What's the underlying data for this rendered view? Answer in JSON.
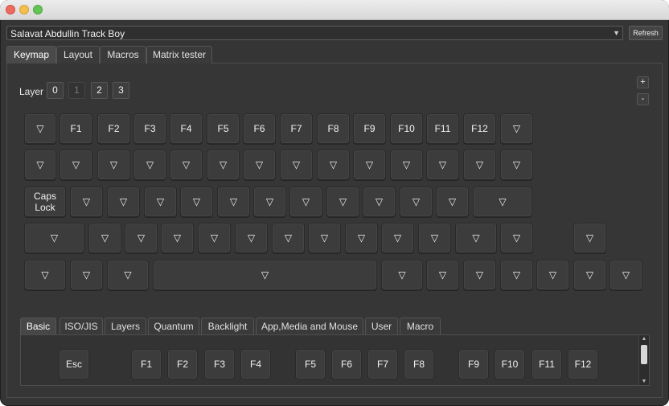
{
  "device": {
    "name": "Salavat Abdullin Track Boy",
    "refresh_label": "Refresh"
  },
  "top_tabs": [
    "Keymap",
    "Layout",
    "Macros",
    "Matrix tester"
  ],
  "active_top_tab": "Keymap",
  "layer": {
    "label": "Layer",
    "options": [
      "0",
      "1",
      "2",
      "3"
    ],
    "active": "1",
    "add_label": "+",
    "remove_label": "-"
  },
  "keymap": {
    "row1": [
      "▽",
      "F1",
      "F2",
      "F3",
      "F4",
      "F5",
      "F6",
      "F7",
      "F8",
      "F9",
      "F10",
      "F11",
      "F12",
      "▽"
    ],
    "row2": [
      "▽",
      "▽",
      "▽",
      "▽",
      "▽",
      "▽",
      "▽",
      "▽",
      "▽",
      "▽",
      "▽",
      "▽",
      "▽",
      "▽"
    ],
    "row3": [
      "Caps\nLock",
      "▽",
      "▽",
      "▽",
      "▽",
      "▽",
      "▽",
      "▽",
      "▽",
      "▽",
      "▽",
      "▽",
      "▽"
    ],
    "row4": [
      "▽",
      "▽",
      "▽",
      "▽",
      "▽",
      "▽",
      "▽",
      "▽",
      "▽",
      "▽",
      "▽",
      "▽",
      "▽",
      "▽"
    ],
    "row5": [
      "▽",
      "▽",
      "▽",
      "▽",
      "▽",
      "▽",
      "▽",
      "▽",
      "▽",
      "▽",
      "▽",
      "▽"
    ]
  },
  "bottom_tabs": [
    "Basic",
    "ISO/JIS",
    "Layers",
    "Quantum",
    "Backlight",
    "App,Media and Mouse",
    "User",
    "Macro"
  ],
  "active_bottom_tab": "Basic",
  "palette_keys": [
    "Esc",
    "F1",
    "F2",
    "F3",
    "F4",
    "F5",
    "F6",
    "F7",
    "F8",
    "F9",
    "F10",
    "F11",
    "F12"
  ],
  "scrollbar": {
    "up_icon": "▲",
    "down_icon": "▼"
  }
}
